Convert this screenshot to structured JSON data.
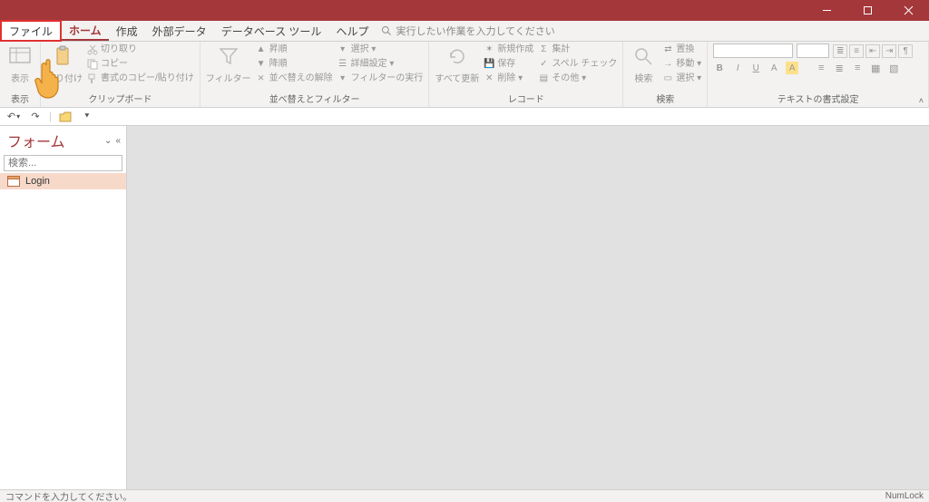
{
  "titlebar": {},
  "tabs": {
    "file": "ファイル",
    "home": "ホーム",
    "create": "作成",
    "external": "外部データ",
    "dbtools": "データベース ツール",
    "help": "ヘルプ",
    "tellme": "実行したい作業を入力してください"
  },
  "ribbon": {
    "view_group": {
      "view": "表示"
    },
    "clipboard_group": {
      "label": "クリップボード",
      "paste": "貼り付け",
      "cut": "切り取り",
      "copy": "コピー",
      "format_painter": "書式のコピー/貼り付け"
    },
    "sort_group": {
      "label": "並べ替えとフィルター",
      "filter": "フィルター",
      "asc": "昇順",
      "desc": "降順",
      "remove_sort": "並べ替えの解除",
      "selection": "選択 ▾",
      "advanced": "詳細設定 ▾",
      "toggle_filter": "フィルターの実行"
    },
    "records_group": {
      "label": "レコード",
      "refresh_all": "すべて更新",
      "new": "新規作成",
      "save": "保存",
      "delete": "削除 ▾",
      "totals": "集計",
      "spelling": "スペル チェック",
      "more": "その他 ▾"
    },
    "find_group": {
      "label": "検索",
      "find": "検索",
      "replace": "置換",
      "goto": "移動 ▾",
      "select": "選択 ▾"
    },
    "format_group": {
      "label": "テキストの書式設定"
    }
  },
  "nav": {
    "title": "フォーム",
    "search_placeholder": "検索...",
    "item1": "Login"
  },
  "status": {
    "left": "コマンドを入力してください。",
    "right": "NumLock"
  }
}
